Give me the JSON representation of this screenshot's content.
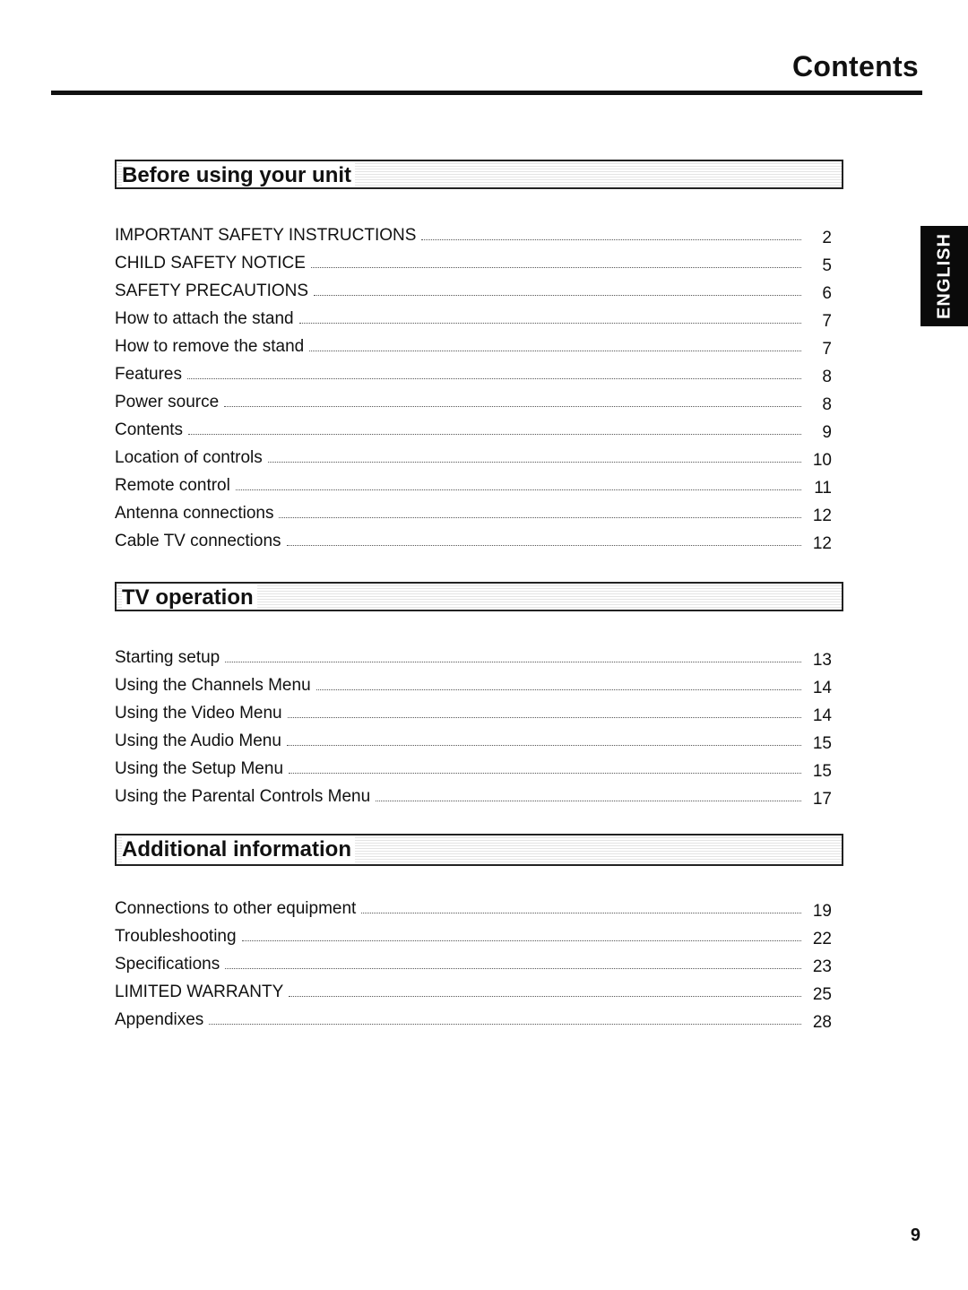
{
  "header": {
    "title": "Contents"
  },
  "language_tab": "ENGLISH",
  "sections": [
    {
      "title": "Before using your unit",
      "entries": [
        {
          "label": "IMPORTANT SAFETY INSTRUCTIONS",
          "page": "2"
        },
        {
          "label": "CHILD SAFETY NOTICE",
          "page": "5"
        },
        {
          "label": "SAFETY PRECAUTIONS",
          "page": "6"
        },
        {
          "label": "How to attach the stand",
          "page": "7"
        },
        {
          "label": "How to remove the stand",
          "page": "7"
        },
        {
          "label": "Features",
          "page": "8"
        },
        {
          "label": "Power source",
          "page": "8"
        },
        {
          "label": "Contents",
          "page": "9"
        },
        {
          "label": "Location of controls",
          "page": "10"
        },
        {
          "label": "Remote control",
          "page": "11"
        },
        {
          "label": "Antenna connections",
          "page": "12"
        },
        {
          "label": "Cable TV connections",
          "page": "12"
        }
      ]
    },
    {
      "title": "TV operation",
      "entries": [
        {
          "label": "Starting setup",
          "page": "13"
        },
        {
          "label": "Using the Channels Menu",
          "page": "14"
        },
        {
          "label": "Using the Video Menu",
          "page": "14"
        },
        {
          "label": "Using the Audio Menu",
          "page": "15"
        },
        {
          "label": "Using the Setup Menu",
          "page": "15"
        },
        {
          "label": "Using the Parental Controls Menu",
          "page": "17"
        }
      ]
    },
    {
      "title": "Additional information",
      "entries": [
        {
          "label": "Connections to other equipment",
          "page": "19"
        },
        {
          "label": "Troubleshooting",
          "page": "22"
        },
        {
          "label": "Specifications",
          "page": "23"
        },
        {
          "label": "LIMITED WARRANTY",
          "page": "25"
        },
        {
          "label": "Appendixes",
          "page": "28"
        }
      ]
    }
  ],
  "footer": {
    "page_number": "9"
  }
}
